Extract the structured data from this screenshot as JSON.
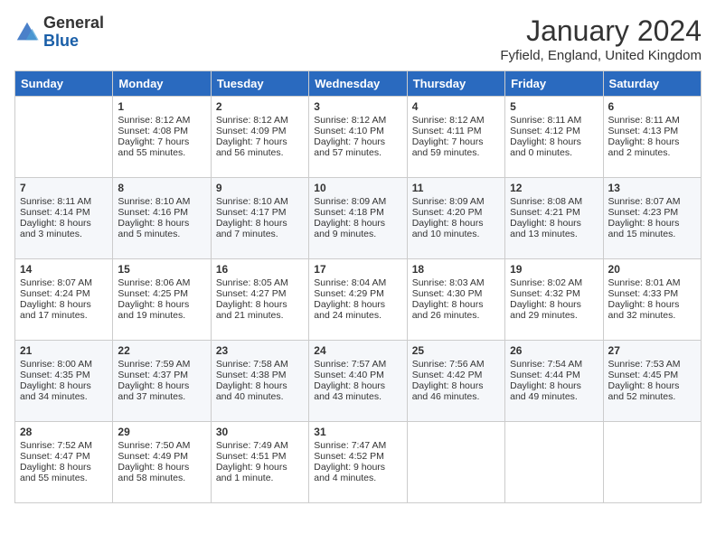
{
  "header": {
    "logo_text_general": "General",
    "logo_text_blue": "Blue",
    "title": "January 2024",
    "subtitle": "Fyfield, England, United Kingdom"
  },
  "weekdays": [
    "Sunday",
    "Monday",
    "Tuesday",
    "Wednesday",
    "Thursday",
    "Friday",
    "Saturday"
  ],
  "weeks": [
    [
      {
        "day": "",
        "sunrise": "",
        "sunset": "",
        "daylight": ""
      },
      {
        "day": "1",
        "sunrise": "Sunrise: 8:12 AM",
        "sunset": "Sunset: 4:08 PM",
        "daylight": "Daylight: 7 hours and 55 minutes."
      },
      {
        "day": "2",
        "sunrise": "Sunrise: 8:12 AM",
        "sunset": "Sunset: 4:09 PM",
        "daylight": "Daylight: 7 hours and 56 minutes."
      },
      {
        "day": "3",
        "sunrise": "Sunrise: 8:12 AM",
        "sunset": "Sunset: 4:10 PM",
        "daylight": "Daylight: 7 hours and 57 minutes."
      },
      {
        "day": "4",
        "sunrise": "Sunrise: 8:12 AM",
        "sunset": "Sunset: 4:11 PM",
        "daylight": "Daylight: 7 hours and 59 minutes."
      },
      {
        "day": "5",
        "sunrise": "Sunrise: 8:11 AM",
        "sunset": "Sunset: 4:12 PM",
        "daylight": "Daylight: 8 hours and 0 minutes."
      },
      {
        "day": "6",
        "sunrise": "Sunrise: 8:11 AM",
        "sunset": "Sunset: 4:13 PM",
        "daylight": "Daylight: 8 hours and 2 minutes."
      }
    ],
    [
      {
        "day": "7",
        "sunrise": "Sunrise: 8:11 AM",
        "sunset": "Sunset: 4:14 PM",
        "daylight": "Daylight: 8 hours and 3 minutes."
      },
      {
        "day": "8",
        "sunrise": "Sunrise: 8:10 AM",
        "sunset": "Sunset: 4:16 PM",
        "daylight": "Daylight: 8 hours and 5 minutes."
      },
      {
        "day": "9",
        "sunrise": "Sunrise: 8:10 AM",
        "sunset": "Sunset: 4:17 PM",
        "daylight": "Daylight: 8 hours and 7 minutes."
      },
      {
        "day": "10",
        "sunrise": "Sunrise: 8:09 AM",
        "sunset": "Sunset: 4:18 PM",
        "daylight": "Daylight: 8 hours and 9 minutes."
      },
      {
        "day": "11",
        "sunrise": "Sunrise: 8:09 AM",
        "sunset": "Sunset: 4:20 PM",
        "daylight": "Daylight: 8 hours and 10 minutes."
      },
      {
        "day": "12",
        "sunrise": "Sunrise: 8:08 AM",
        "sunset": "Sunset: 4:21 PM",
        "daylight": "Daylight: 8 hours and 13 minutes."
      },
      {
        "day": "13",
        "sunrise": "Sunrise: 8:07 AM",
        "sunset": "Sunset: 4:23 PM",
        "daylight": "Daylight: 8 hours and 15 minutes."
      }
    ],
    [
      {
        "day": "14",
        "sunrise": "Sunrise: 8:07 AM",
        "sunset": "Sunset: 4:24 PM",
        "daylight": "Daylight: 8 hours and 17 minutes."
      },
      {
        "day": "15",
        "sunrise": "Sunrise: 8:06 AM",
        "sunset": "Sunset: 4:25 PM",
        "daylight": "Daylight: 8 hours and 19 minutes."
      },
      {
        "day": "16",
        "sunrise": "Sunrise: 8:05 AM",
        "sunset": "Sunset: 4:27 PM",
        "daylight": "Daylight: 8 hours and 21 minutes."
      },
      {
        "day": "17",
        "sunrise": "Sunrise: 8:04 AM",
        "sunset": "Sunset: 4:29 PM",
        "daylight": "Daylight: 8 hours and 24 minutes."
      },
      {
        "day": "18",
        "sunrise": "Sunrise: 8:03 AM",
        "sunset": "Sunset: 4:30 PM",
        "daylight": "Daylight: 8 hours and 26 minutes."
      },
      {
        "day": "19",
        "sunrise": "Sunrise: 8:02 AM",
        "sunset": "Sunset: 4:32 PM",
        "daylight": "Daylight: 8 hours and 29 minutes."
      },
      {
        "day": "20",
        "sunrise": "Sunrise: 8:01 AM",
        "sunset": "Sunset: 4:33 PM",
        "daylight": "Daylight: 8 hours and 32 minutes."
      }
    ],
    [
      {
        "day": "21",
        "sunrise": "Sunrise: 8:00 AM",
        "sunset": "Sunset: 4:35 PM",
        "daylight": "Daylight: 8 hours and 34 minutes."
      },
      {
        "day": "22",
        "sunrise": "Sunrise: 7:59 AM",
        "sunset": "Sunset: 4:37 PM",
        "daylight": "Daylight: 8 hours and 37 minutes."
      },
      {
        "day": "23",
        "sunrise": "Sunrise: 7:58 AM",
        "sunset": "Sunset: 4:38 PM",
        "daylight": "Daylight: 8 hours and 40 minutes."
      },
      {
        "day": "24",
        "sunrise": "Sunrise: 7:57 AM",
        "sunset": "Sunset: 4:40 PM",
        "daylight": "Daylight: 8 hours and 43 minutes."
      },
      {
        "day": "25",
        "sunrise": "Sunrise: 7:56 AM",
        "sunset": "Sunset: 4:42 PM",
        "daylight": "Daylight: 8 hours and 46 minutes."
      },
      {
        "day": "26",
        "sunrise": "Sunrise: 7:54 AM",
        "sunset": "Sunset: 4:44 PM",
        "daylight": "Daylight: 8 hours and 49 minutes."
      },
      {
        "day": "27",
        "sunrise": "Sunrise: 7:53 AM",
        "sunset": "Sunset: 4:45 PM",
        "daylight": "Daylight: 8 hours and 52 minutes."
      }
    ],
    [
      {
        "day": "28",
        "sunrise": "Sunrise: 7:52 AM",
        "sunset": "Sunset: 4:47 PM",
        "daylight": "Daylight: 8 hours and 55 minutes."
      },
      {
        "day": "29",
        "sunrise": "Sunrise: 7:50 AM",
        "sunset": "Sunset: 4:49 PM",
        "daylight": "Daylight: 8 hours and 58 minutes."
      },
      {
        "day": "30",
        "sunrise": "Sunrise: 7:49 AM",
        "sunset": "Sunset: 4:51 PM",
        "daylight": "Daylight: 9 hours and 1 minute."
      },
      {
        "day": "31",
        "sunrise": "Sunrise: 7:47 AM",
        "sunset": "Sunset: 4:52 PM",
        "daylight": "Daylight: 9 hours and 4 minutes."
      },
      {
        "day": "",
        "sunrise": "",
        "sunset": "",
        "daylight": ""
      },
      {
        "day": "",
        "sunrise": "",
        "sunset": "",
        "daylight": ""
      },
      {
        "day": "",
        "sunrise": "",
        "sunset": "",
        "daylight": ""
      }
    ]
  ]
}
